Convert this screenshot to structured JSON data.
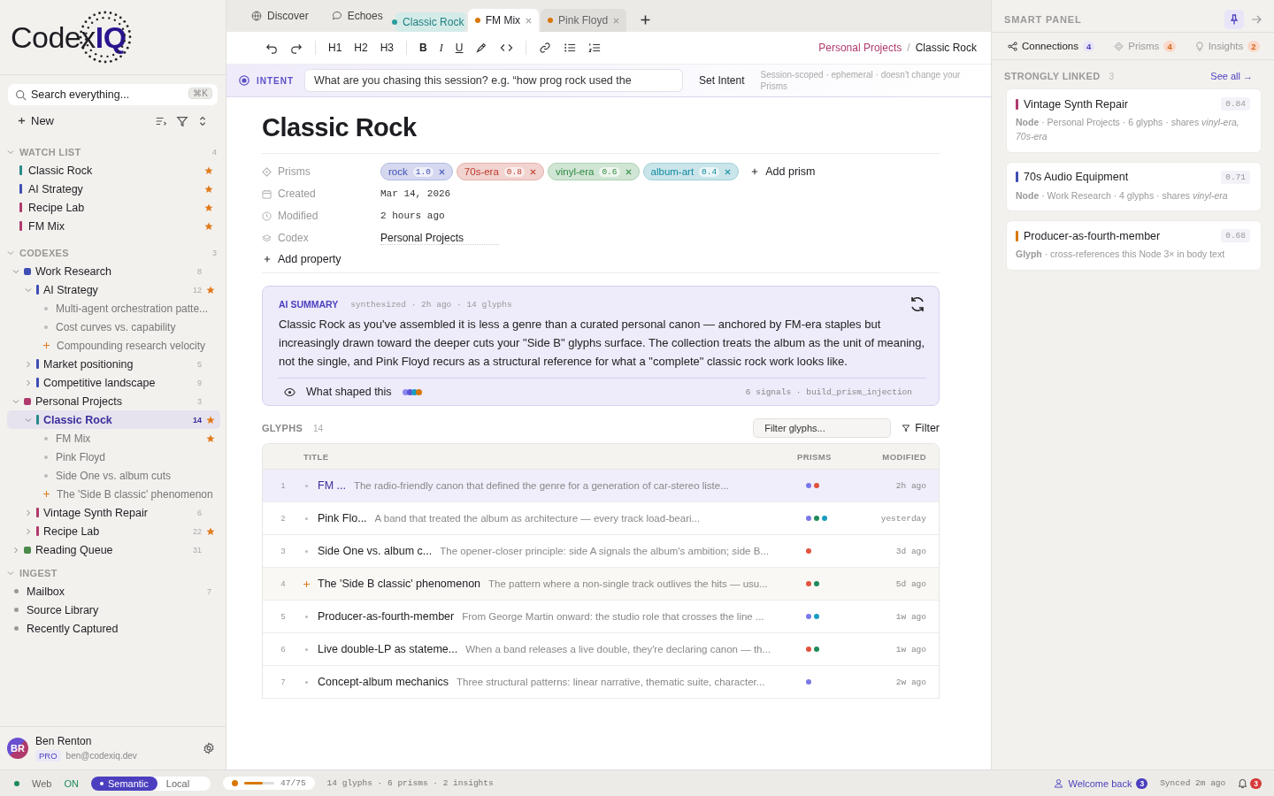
{
  "sidebar": {
    "logo": {
      "text": "Codex",
      "accent": "IQ"
    },
    "search": {
      "placeholder": "Search everything...",
      "shortcut": "⌘K"
    },
    "new_label": "New",
    "watch_list": {
      "title": "WATCH LIST",
      "count": "4",
      "expanded": true,
      "items": [
        {
          "label": "Classic Rock",
          "color": "#2a8a8a",
          "starred": true
        },
        {
          "label": "AI Strategy",
          "color": "#3f4fb5",
          "starred": true
        },
        {
          "label": "Recipe Lab",
          "color": "#b03a6c",
          "starred": true
        },
        {
          "label": "FM Mix",
          "color": "#b03a6c",
          "starred": true
        }
      ]
    },
    "codexes": {
      "title": "CODEXES",
      "count": "3",
      "expanded": true,
      "items": [
        {
          "kind": "codex",
          "label": "Work Research",
          "color": "#3f4fb5",
          "count": "8",
          "expanded": true,
          "selected": false,
          "children": [
            {
              "kind": "node",
              "label": "AI Strategy",
              "color": "#3f4fb5",
              "count": "12",
              "expanded": true,
              "starred": true,
              "selected": false,
              "children": [
                {
                  "kind": "glyph",
                  "label": "Multi-agent orchestration patte...",
                  "starred": false,
                  "selected": false
                },
                {
                  "kind": "glyph",
                  "label": "Cost curves vs. capability",
                  "starred": false,
                  "selected": false
                },
                {
                  "kind": "insight",
                  "label": "Compounding research velocity",
                  "starred": false,
                  "selected": false
                }
              ]
            },
            {
              "kind": "node",
              "label": "Market positioning",
              "color": "#3f4fb5",
              "count": "5",
              "expanded": false,
              "starred": false,
              "selected": false
            },
            {
              "kind": "node",
              "label": "Competitive landscape",
              "color": "#3f4fb5",
              "count": "9",
              "expanded": false,
              "starred": false,
              "selected": false
            }
          ]
        },
        {
          "kind": "codex",
          "label": "Personal Projects",
          "color": "#b03a6c",
          "count": "3",
          "expanded": true,
          "selected": false,
          "children": [
            {
              "kind": "node",
              "label": "Classic Rock",
              "color": "#2a8a8a",
              "count": "14",
              "expanded": true,
              "starred": true,
              "selected": true,
              "children": [
                {
                  "kind": "glyph",
                  "label": "FM Mix",
                  "starred": true,
                  "selected": false
                },
                {
                  "kind": "glyph",
                  "label": "Pink Floyd",
                  "starred": false,
                  "selected": false
                },
                {
                  "kind": "glyph",
                  "label": "Side One vs. album cuts",
                  "starred": false,
                  "selected": false
                },
                {
                  "kind": "insight",
                  "label": "The 'Side B classic' phenomenon",
                  "starred": false,
                  "selected": false
                }
              ]
            },
            {
              "kind": "node",
              "label": "Vintage Synth Repair",
              "color": "#b03a6c",
              "count": "6",
              "expanded": false,
              "starred": false,
              "selected": false
            },
            {
              "kind": "node",
              "label": "Recipe Lab",
              "color": "#b03a6c",
              "count": "22",
              "expanded": false,
              "starred": true,
              "selected": false
            }
          ]
        },
        {
          "kind": "codex",
          "label": "Reading Queue",
          "color": "#4a8a4a",
          "count": "31",
          "expanded": false,
          "selected": false
        }
      ]
    },
    "ingest": {
      "title": "INGEST",
      "expanded": true,
      "items": [
        {
          "label": "Mailbox",
          "count": "7"
        },
        {
          "label": "Source Library"
        },
        {
          "label": "Recently Captured"
        }
      ]
    },
    "user": {
      "initials": "BR",
      "name": "Ben Renton",
      "plan": "PRO",
      "email": "ben@codexiq.dev"
    }
  },
  "tabs": {
    "nav": [
      {
        "label": "Discover"
      },
      {
        "label": "Echoes"
      }
    ],
    "documents": [
      {
        "label": "Classic Rock",
        "color": "#2a9d9d",
        "selected": false,
        "pinned": true
      },
      {
        "label": "FM Mix",
        "color": "#d97706",
        "selected": true,
        "pinned": false
      },
      {
        "label": "Pink Floyd",
        "color": "#d97706",
        "selected": false,
        "pinned": false
      }
    ]
  },
  "toolbar": {
    "headings": [
      "H1",
      "H2",
      "H3"
    ],
    "marks": [
      "B",
      "I",
      "U"
    ],
    "breadcrumb": [
      "Personal Projects",
      "Classic Rock"
    ],
    "breadcrumb_separator": "/"
  },
  "intent": {
    "label": "INTENT",
    "placeholder": "What are you chasing this session? e.g. “how prog rock used the",
    "button": "Set Intent",
    "note": "Session-scoped · ephemeral · doesn't change your Prisms"
  },
  "document": {
    "title": "Classic Rock",
    "properties": [
      {
        "kind": "prisms",
        "label": "Prisms",
        "chips": [
          {
            "label": "rock",
            "weight": "1.0",
            "color": "#3f4fb5"
          },
          {
            "label": "70s-era",
            "weight": "0.8",
            "color": "#c0392b"
          },
          {
            "label": "vinyl-era",
            "weight": "0.6",
            "color": "#2e8b3f"
          },
          {
            "label": "album-art",
            "weight": "0.4",
            "color": "#0e8aa0"
          }
        ],
        "add": "Add prism"
      },
      {
        "kind": "date",
        "label": "Created",
        "value": "Mar 14, 2026"
      },
      {
        "kind": "clock",
        "label": "Modified",
        "value": "2 hours ago"
      },
      {
        "kind": "codex",
        "label": "Codex",
        "value": "Personal Projects"
      }
    ],
    "add_property": "Add property"
  },
  "summary": {
    "label": "AI SUMMARY",
    "meta": "synthesized · 2h ago · 14 glyphs",
    "text": "Classic Rock as you've assembled it is less a genre than a curated personal canon — anchored by FM-era staples but increasingly drawn toward the deeper cuts your \"Side B\" glyphs surface. The collection treats the album as the unit of meaning, not the single, and Pink Floyd recurs as a structural reference for what a \"complete\" classic rock work looks like.",
    "shaped_label": "What shaped this",
    "signals": [
      {
        "color": "#8b87ef"
      },
      {
        "color": "#5b54d6"
      },
      {
        "color": "#1a9cc0"
      },
      {
        "color": "#d97706"
      }
    ],
    "footer": "6 signals · build_prism_injection"
  },
  "glyphs": {
    "title": "GLYPHS",
    "count": "14",
    "filter_placeholder": "Filter glyphs...",
    "filter_button": "Filter",
    "columns": [
      "TITLE",
      "PRISMS",
      "MODIFIED"
    ],
    "rows": [
      {
        "num": "1",
        "kind": "glyph",
        "title": "FM ...",
        "desc": "The radio-friendly canon that defined the genre for a generation of car-stereo liste...",
        "prisms": [
          {
            "color": "#7b78e8"
          },
          {
            "color": "#e0533d"
          }
        ],
        "modified": "2h ago",
        "selected": true
      },
      {
        "num": "2",
        "kind": "glyph",
        "title": "Pink Flo...",
        "desc": "A band that treated the album as architecture — every track load-beari...",
        "prisms": [
          {
            "color": "#7b78e8"
          },
          {
            "color": "#1f8a5a"
          },
          {
            "color": "#1a9cc0"
          }
        ],
        "modified": "yesterday",
        "selected": false
      },
      {
        "num": "3",
        "kind": "glyph",
        "title": "Side One vs. album c...",
        "desc": "The opener-closer principle: side A signals the album's ambition; side B...",
        "prisms": [
          {
            "color": "#e0533d"
          }
        ],
        "modified": "3d ago",
        "selected": false
      },
      {
        "num": "4",
        "kind": "insight",
        "title": "The 'Side B classic' phenomenon",
        "desc": "The pattern where a non-single track outlives the hits — usu...",
        "prisms": [
          {
            "color": "#e0533d"
          },
          {
            "color": "#1f8a5a"
          }
        ],
        "modified": "5d ago",
        "selected": false
      },
      {
        "num": "5",
        "kind": "glyph",
        "title": "Producer-as-fourth-member",
        "desc": "From George Martin onward: the studio role that crosses the line ...",
        "prisms": [
          {
            "color": "#7b78e8"
          },
          {
            "color": "#1a9cc0"
          }
        ],
        "modified": "1w ago",
        "selected": false
      },
      {
        "num": "6",
        "kind": "glyph",
        "title": "Live double-LP as stateme...",
        "desc": "When a band releases a live double, they're declaring canon — th...",
        "prisms": [
          {
            "color": "#e0533d"
          },
          {
            "color": "#1f8a5a"
          }
        ],
        "modified": "1w ago",
        "selected": false
      },
      {
        "num": "7",
        "kind": "glyph",
        "title": "Concept-album mechanics",
        "desc": "Three structural patterns: linear narrative, thematic suite, character...",
        "prisms": [
          {
            "color": "#7b78e8"
          }
        ],
        "modified": "2w ago",
        "selected": false
      }
    ]
  },
  "smart_panel": {
    "title": "SMART PANEL",
    "tabs": [
      {
        "label": "Connections",
        "count": "4",
        "selected": true
      },
      {
        "label": "Prisms",
        "count": "4",
        "selected": false
      },
      {
        "label": "Insights",
        "count": "2",
        "selected": false
      }
    ],
    "section": {
      "title": "STRONGLY LINKED",
      "count": "3",
      "link": "See all →"
    },
    "cards": [
      {
        "title": "Vintage Synth Repair",
        "color": "#b03a6c",
        "score": "0.84",
        "meta": "**Node** · Personal Projects · 6 glyphs · shares *vinyl-era, 70s-era*"
      },
      {
        "title": "70s Audio Equipment",
        "color": "#3f4fb5",
        "score": "0.71",
        "meta": "**Node** · Work Research · 4 glyphs · shares *vinyl-era*"
      },
      {
        "title": "Producer-as-fourth-member",
        "color": "#d97706",
        "score": "0.68",
        "meta": "**Glyph** · cross-references this Node 3× in body text"
      }
    ]
  },
  "status_bar": {
    "web_label": "Web",
    "web_state": "ON",
    "modes": [
      {
        "label": "Semantic",
        "selected": true
      },
      {
        "label": "Local",
        "selected": false
      }
    ],
    "progress": {
      "level": 0.627,
      "text": "47/75"
    },
    "stats": "14 glyphs · 6 prisms · 2 insights",
    "welcome": "Welcome back",
    "welcome_count": "3",
    "synced": "Synced 2m ago",
    "notifications": "3"
  }
}
